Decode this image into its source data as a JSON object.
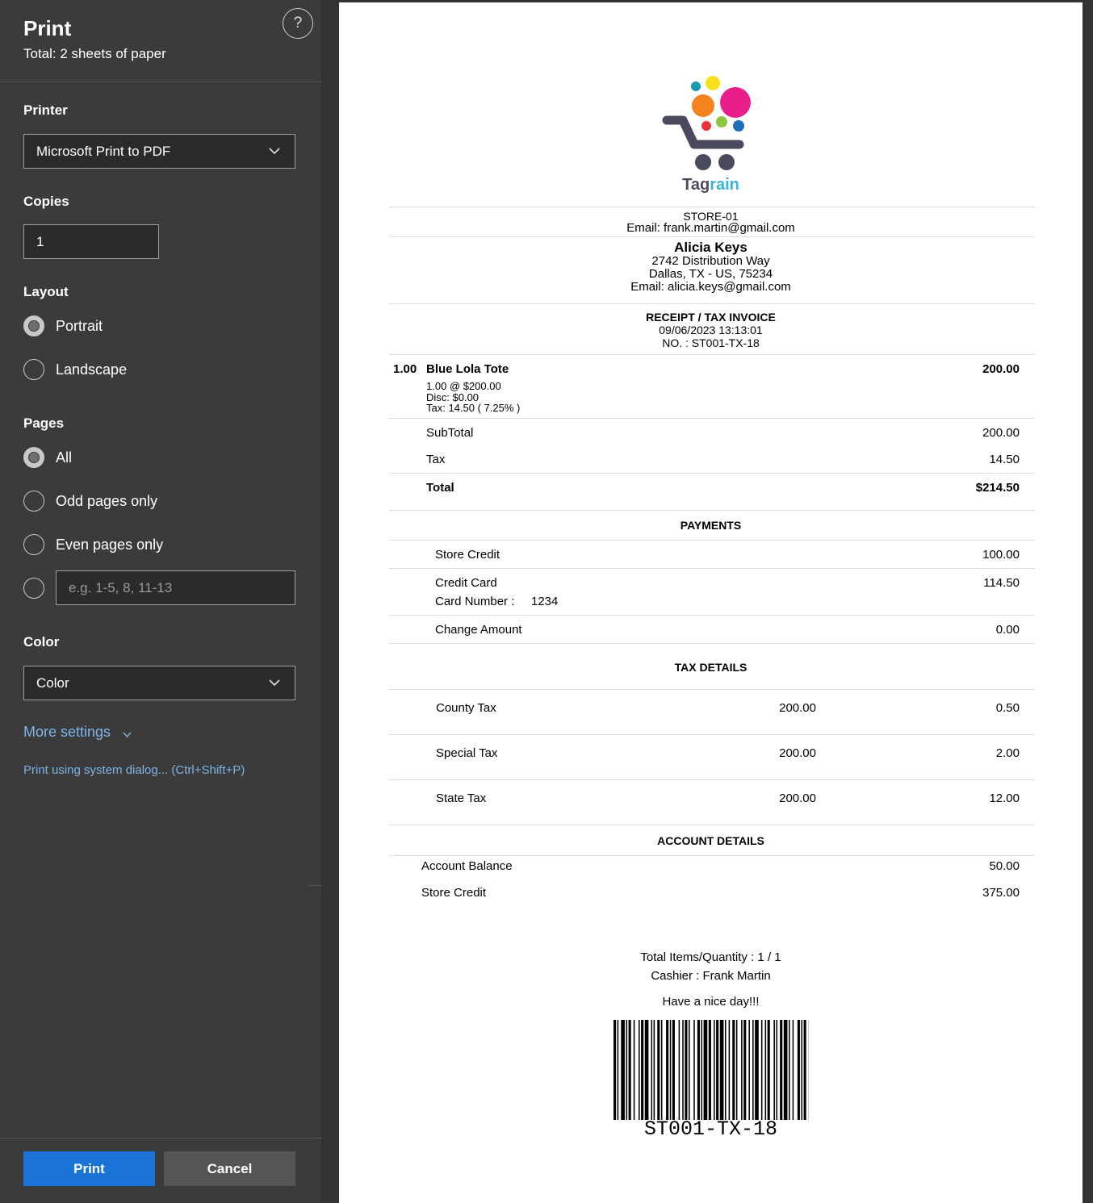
{
  "panel": {
    "title": "Print",
    "sheets": "Total: 2 sheets of paper",
    "help": "?",
    "printer_label": "Printer",
    "printer_value": "Microsoft Print to PDF",
    "copies_label": "Copies",
    "copies_value": "1",
    "layout_label": "Layout",
    "layout_options": [
      "Portrait",
      "Landscape"
    ],
    "layout_selected": "Portrait",
    "pages_label": "Pages",
    "pages_options": [
      "All",
      "Odd pages only",
      "Even pages only"
    ],
    "pages_selected": "All",
    "page_range_placeholder": "e.g. 1-5, 8, 11-13",
    "color_label": "Color",
    "color_value": "Color",
    "more_settings": "More settings",
    "system_dialog": "Print using system dialog... (Ctrl+Shift+P)",
    "print_button": "Print",
    "cancel_button": "Cancel"
  },
  "receipt": {
    "brand": "Tagrain",
    "store": "STORE-01",
    "store_email": "Email: frank.martin@gmail.com",
    "customer": {
      "name": "Alicia Keys",
      "address1": "2742 Distribution Way",
      "address2": "Dallas, TX - US, 75234",
      "email": "Email: alicia.keys@gmail.com"
    },
    "doc_title": "RECEIPT / TAX INVOICE",
    "datetime": "09/06/2023 13:13:01",
    "number": "NO. : ST001-TX-18",
    "item": {
      "qty": "1.00",
      "name": "Blue Lola Tote",
      "amount": "200.00",
      "unit_line": "1.00 @ $200.00",
      "disc_line": "Disc: $0.00",
      "tax_line": "Tax: 14.50 ( 7.25% )"
    },
    "subtotal_label": "SubTotal",
    "subtotal": "200.00",
    "tax_label": "Tax",
    "tax": "14.50",
    "total_label": "Total",
    "total": "$214.50",
    "payments_title": "PAYMENTS",
    "payments": {
      "store_credit_label": "Store Credit",
      "store_credit": "100.00",
      "credit_card_label": "Credit Card",
      "credit_card": "114.50",
      "card_number_label": "Card Number :",
      "card_number": "1234",
      "change_label": "Change Amount",
      "change": "0.00"
    },
    "tax_details_title": "TAX DETAILS",
    "tax_details": [
      {
        "name": "County Tax",
        "base": "200.00",
        "amount": "0.50"
      },
      {
        "name": "Special Tax",
        "base": "200.00",
        "amount": "2.00"
      },
      {
        "name": "State Tax",
        "base": "200.00",
        "amount": "12.00"
      }
    ],
    "account_title": "ACCOUNT DETAILS",
    "account": {
      "balance_label": "Account Balance",
      "balance": "50.00",
      "store_credit_label": "Store Credit",
      "store_credit": "375.00"
    },
    "total_items": "Total Items/Quantity : 1 / 1",
    "cashier": "Cashier : Frank Martin",
    "greeting": "Have a nice day!!!",
    "barcode_text": "ST001-TX-18"
  },
  "colors": {
    "panel_bg": "#3b3b3b",
    "accent_blue": "#1a73d6",
    "link_blue": "#7fb3e8",
    "logo_magenta": "#e91e8c",
    "logo_orange": "#f5821f",
    "logo_yellow": "#f7e01b",
    "logo_teal": "#1a9ab0",
    "logo_green": "#8cc63f",
    "logo_red": "#e8313a",
    "logo_blue": "#1c6fb8",
    "cart_gray": "#4a4a5e"
  }
}
